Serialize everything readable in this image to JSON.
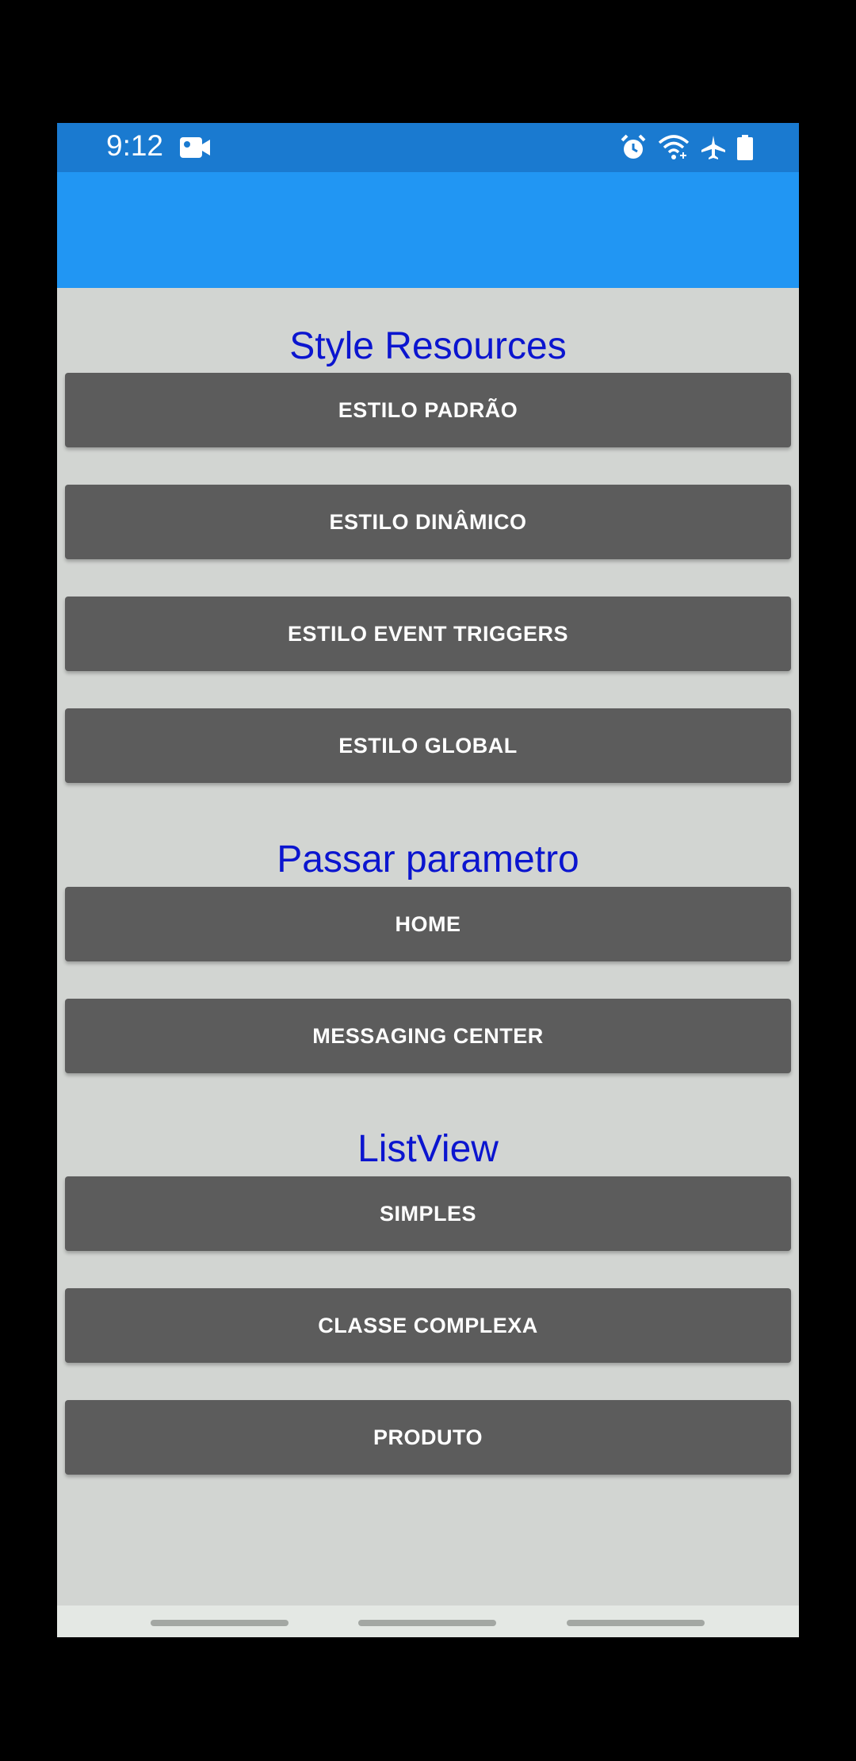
{
  "status_bar": {
    "time": "9:12",
    "icons": [
      "video-camera-icon",
      "alarm-icon",
      "wifi-icon",
      "airplane-icon",
      "battery-icon"
    ]
  },
  "colors": {
    "status_bar": "#1a7ad0",
    "app_bar": "#2196f3",
    "background": "#d2d5d2",
    "section_title": "#0b15cf",
    "button": "#5c5c5c",
    "button_text": "#ffffff"
  },
  "sections": [
    {
      "title": "Style Resources",
      "buttons": [
        "ESTILO PADRÃO",
        "ESTILO DINÂMICO",
        "ESTILO EVENT TRIGGERS",
        "ESTILO GLOBAL"
      ]
    },
    {
      "title": "Passar parametro",
      "buttons": [
        "HOME",
        "MESSAGING CENTER"
      ]
    },
    {
      "title": "ListView",
      "buttons": [
        "SIMPLES",
        "CLASSE COMPLEXA",
        "PRODUTO"
      ]
    }
  ]
}
